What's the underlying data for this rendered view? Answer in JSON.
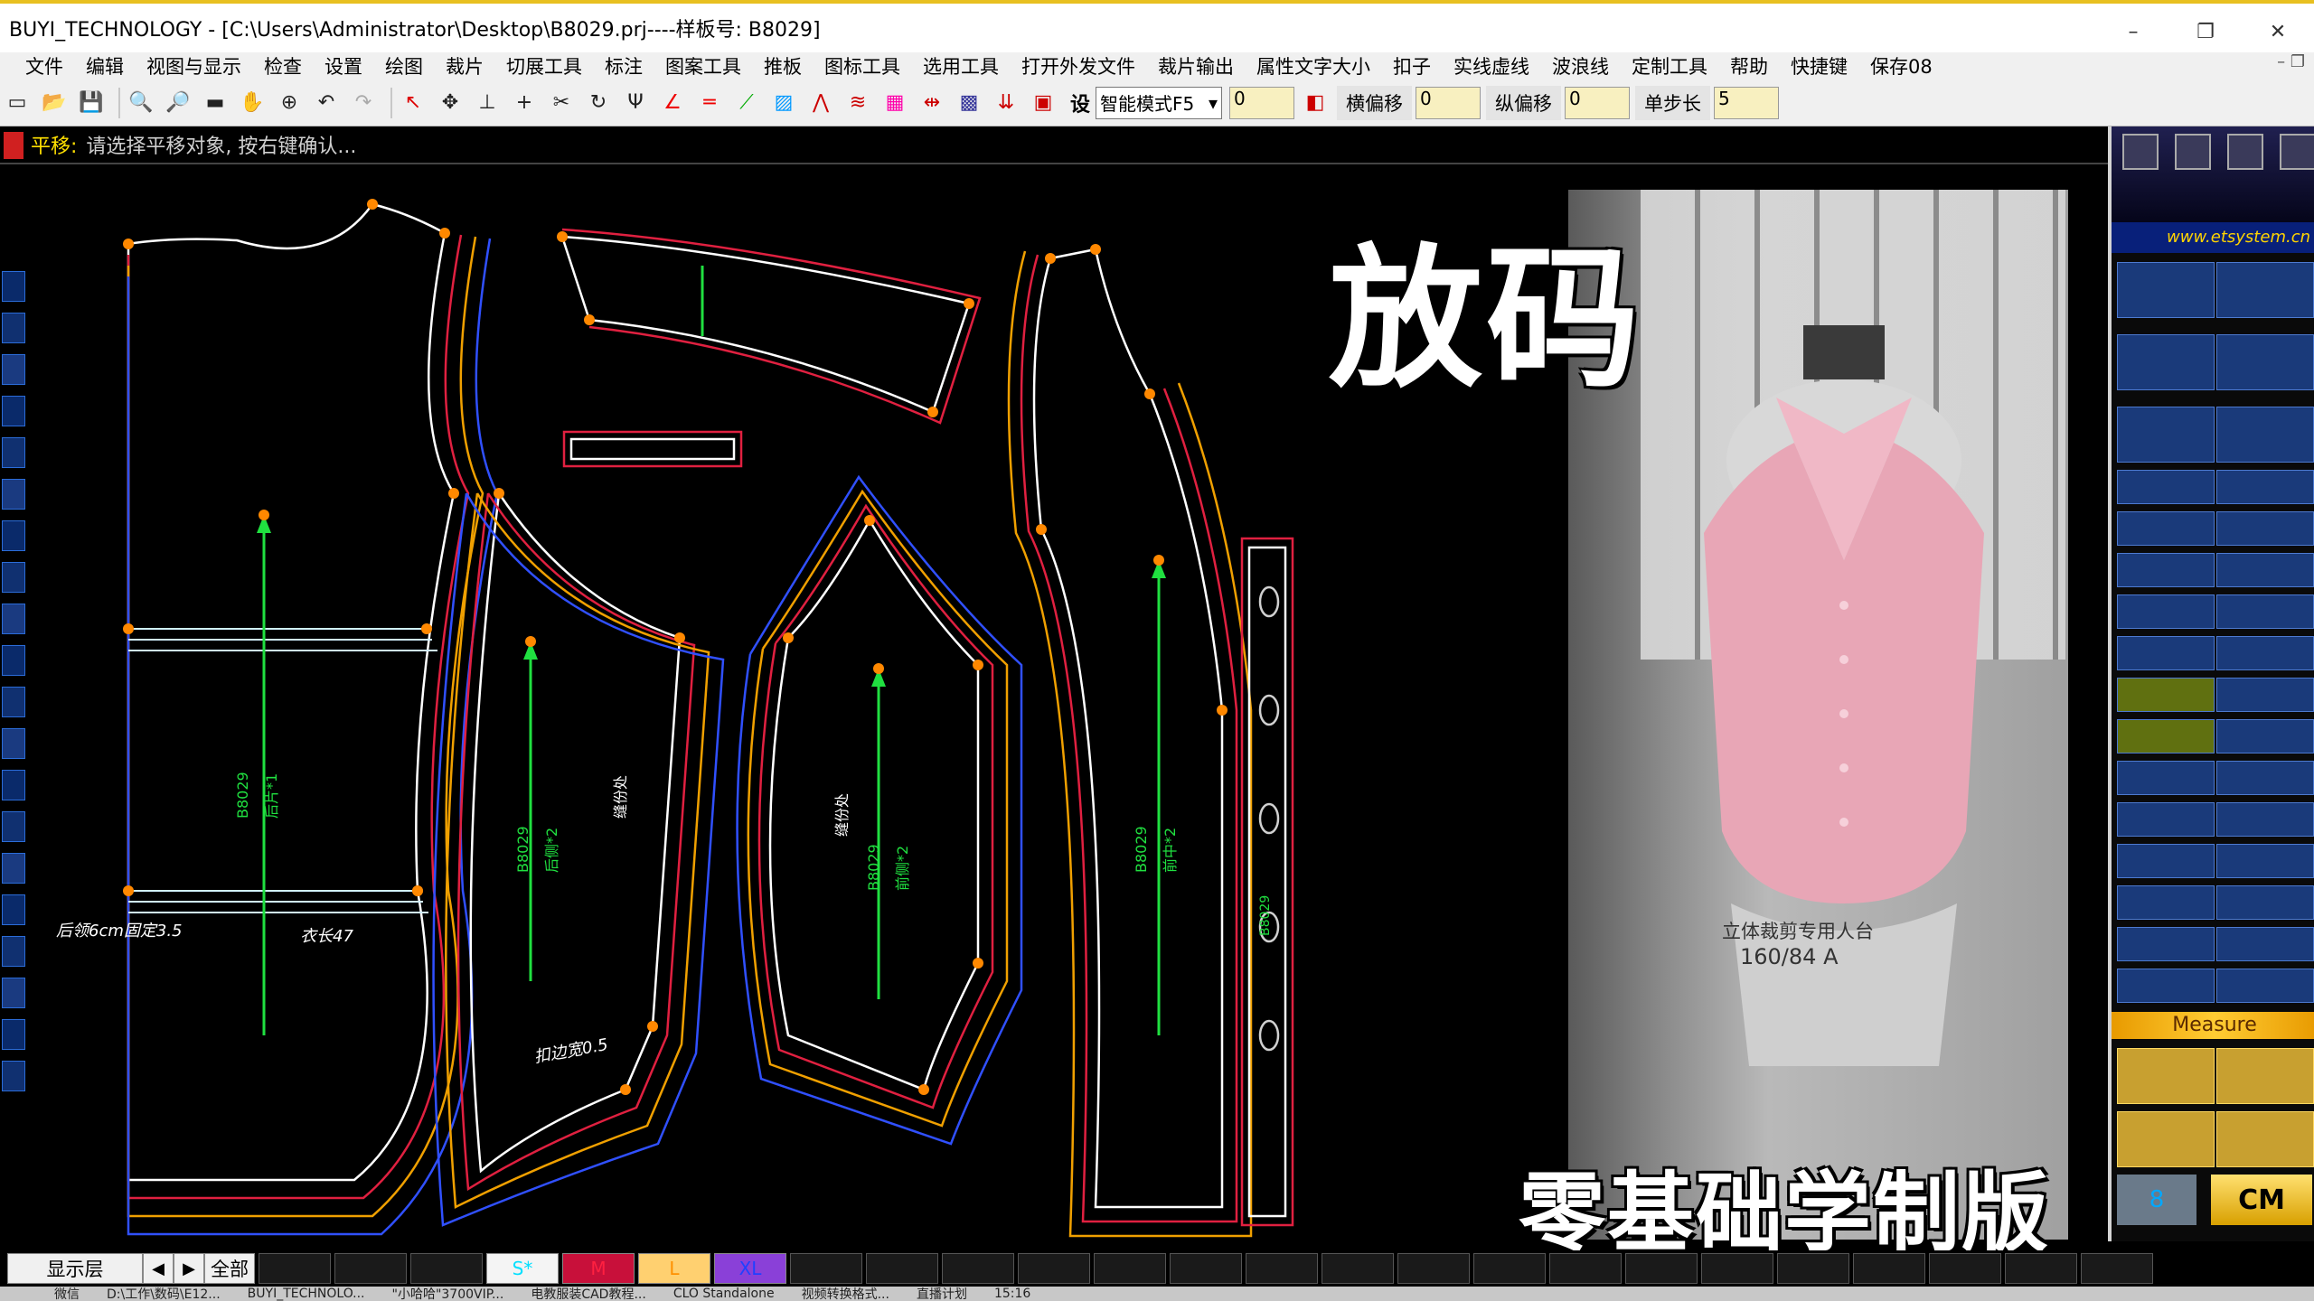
{
  "window": {
    "title": "BUYI_TECHNOLOGY - [C:\\Users\\Administrator\\Desktop\\B8029.prj----样板号: B8029]",
    "controls": [
      "–",
      "❐",
      "✕"
    ]
  },
  "menu": {
    "items": [
      "文件",
      "编辑",
      "视图与显示",
      "检查",
      "设置",
      "绘图",
      "裁片",
      "切展工具",
      "标注",
      "图案工具",
      "推板",
      "图标工具",
      "选用工具",
      "打开外发文件",
      "裁片输出",
      "属性文字大小",
      "扣子",
      "实线虚线",
      "波浪线",
      "定制工具",
      "帮助",
      "快捷键",
      "保存08"
    ]
  },
  "toolbar": {
    "set_label": "设",
    "mode_select": "智能模式F5",
    "offset_value": "0",
    "h_offset_label": "横偏移",
    "h_offset_value": "0",
    "v_offset_label": "纵偏移",
    "v_offset_value": "0",
    "step_label": "单步长",
    "step_value": "5"
  },
  "prompt": {
    "key": "平移:",
    "message": "请选择平移对象, 按右键确认..."
  },
  "overlay": {
    "title": "放码",
    "subtitle": "零基础学制版"
  },
  "pattern_labels": {
    "piece1_code": "B8029",
    "piece1_name": "后片*1",
    "piece2_code": "B8029",
    "piece2_name": "后侧*2",
    "piece3_code": "B8029",
    "piece3_name": "前侧*2",
    "piece4_code": "B8029",
    "piece4_name": "前中*2",
    "piece5_code": "B8029",
    "note_left": "后领6cm固定3.5",
    "note_length": "衣长47",
    "note_hem": "扣边宽0.5",
    "note_side": "缝份处"
  },
  "photo": {
    "mannequin_line1": "立体裁剪专用人台",
    "mannequin_line2": "160/84 A",
    "shirt_color": "#e8a6b6"
  },
  "right_panel": {
    "url": "www.etsystem.cn",
    "measure_label": "Measure",
    "unit_label": "CM",
    "num_label": "8"
  },
  "bottom": {
    "layer_label": "显示层",
    "all_label": "全部",
    "sizes": [
      {
        "name": "S*",
        "color": "#00e0ff",
        "bg": "#f4f4f4"
      },
      {
        "name": "M",
        "color": "#ff2040",
        "bg": "#c8103a"
      },
      {
        "name": "L",
        "color": "#ff9000",
        "bg": "#ffd070"
      },
      {
        "name": "XL",
        "color": "#2040ff",
        "bg": "#8a40d8"
      }
    ]
  },
  "taskbar": {
    "items": [
      "微信",
      "D:\\工作\\数码\\E12...",
      "BUYI_TECHNOLO...",
      "\"小哈哈\"3700VIP...",
      "电教服装CAD教程...",
      "CLO Standalone",
      "视频转换格式...",
      "直播计划",
      "15:16"
    ]
  },
  "colors": {
    "size_s": "#ffffff",
    "size_m": "#e02040",
    "size_l": "#f0a000",
    "size_xl": "#3050ff",
    "grainline": "#20e040",
    "points": "#ff8800"
  }
}
